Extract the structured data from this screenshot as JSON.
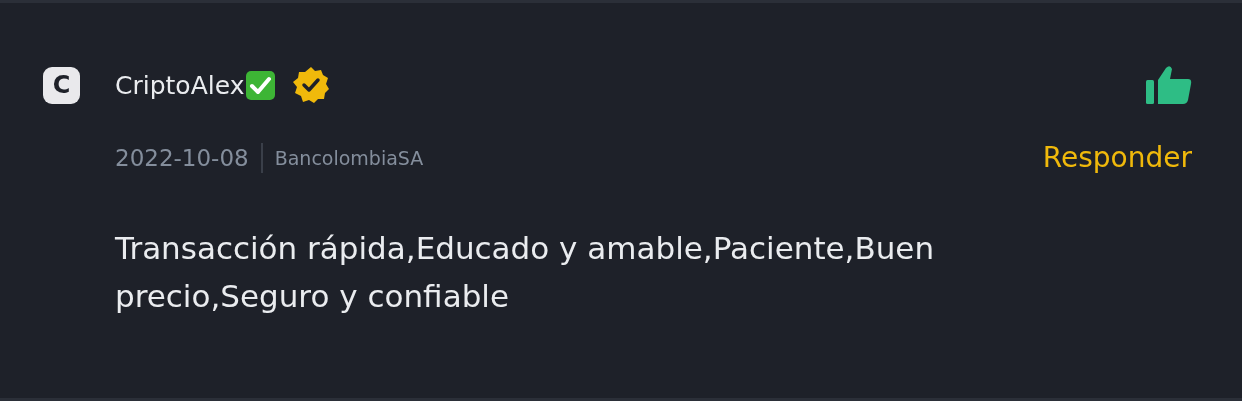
{
  "review": {
    "avatar_letter": "C",
    "user": "CriptoAlex",
    "feedback": {
      "kind": "positive"
    },
    "date": "2022-10-08",
    "payment_method": "BancolombiaSA",
    "reply_label": "Responder",
    "comment": "Transacción rápida,Educado y amable,Paciente,Buen precio,Seguro y confiable"
  }
}
